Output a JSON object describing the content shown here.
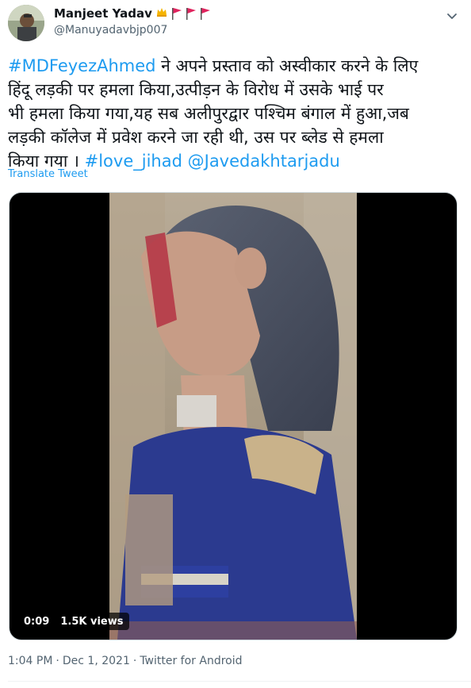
{
  "author": {
    "display_name": "Manjeet Yadav",
    "handle": "@Manuyadavbjp007"
  },
  "tweet": {
    "hashtag_lead": "#MDFeyezAhmed",
    "body": " ने अपने प्रस्ताव को अस्वीकार करने के लिए\nहिंदू लड़की पर हमला किया,उत्पीड़न के विरोध में उसके भाई पर\nभी हमला किया गया,यह सब अलीपुरद्वार पश्चिम बंगाल में हुआ,जब\nलड़की कॉलेज में प्रवेश करने जा रही थी, उस पर ब्लेड से हमला\nकिया गया । ",
    "hashtag_trail": "#love_jihad",
    "mention": "@Javedakhtarjadu",
    "translate_label": "Translate Tweet"
  },
  "video": {
    "time": "0:09",
    "views": "1.5K views"
  },
  "meta": {
    "time": "1:04 PM",
    "sep1": "·",
    "date": "Dec 1, 2021",
    "sep2": "·",
    "source": "Twitter for Android"
  },
  "colors": {
    "link": "#1d9bf0",
    "flag": "#e0245e",
    "secondary_text": "#536471"
  }
}
